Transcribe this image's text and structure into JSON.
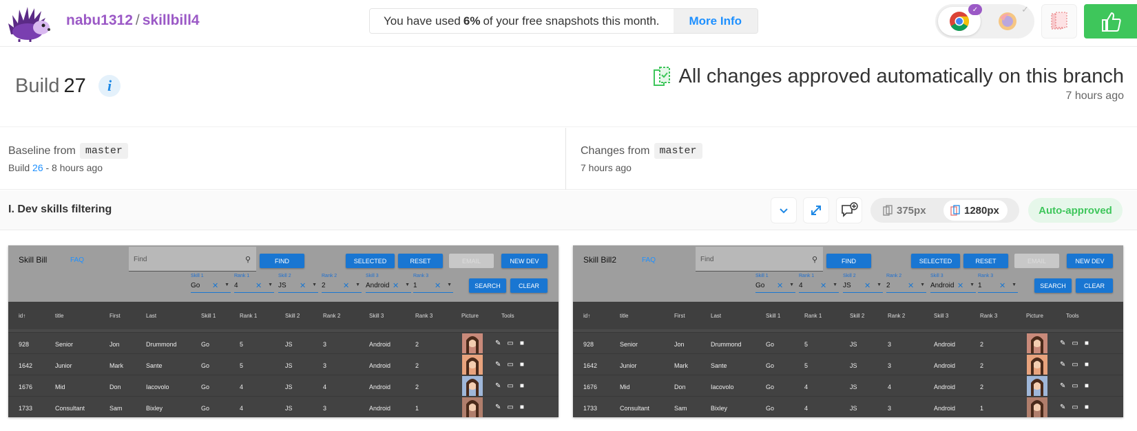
{
  "header": {
    "owner": "nabu1312",
    "separator": "/",
    "repo": "skillbill4",
    "notice_prefix": "You have used",
    "notice_percent": "6%",
    "notice_suffix": "of your free snapshots this month.",
    "notice_link": "More Info",
    "browser_badge": "✓",
    "browser_check": "✓"
  },
  "build": {
    "label": "Build",
    "number": "27",
    "info": "i",
    "status": "All changes approved automatically on this branch",
    "status_time": "7 hours ago"
  },
  "baseline": {
    "label": "Baseline from",
    "branch": "master",
    "build_prefix": "Build",
    "build_number": "26",
    "build_suffix": "- 8 hours ago"
  },
  "changes": {
    "label": "Changes from",
    "branch": "master",
    "time": "7 hours ago"
  },
  "snapshot": {
    "name": "I. Dev skills filtering",
    "width_small": "375px",
    "width_large": "1280px",
    "status": "Auto-approved"
  },
  "app_left": {
    "title": "Skill Bill",
    "faq": "FAQ"
  },
  "app_right": {
    "title": "Skill Bill2",
    "faq": "FAQ"
  },
  "app": {
    "find_placeholder": "Find",
    "find": "FIND",
    "selected": "SELECTED",
    "reset": "RESET",
    "email": "EMAIL",
    "new_dev": "NEW DEV",
    "search": "SEARCH",
    "clear": "CLEAR",
    "filters": [
      {
        "label": "Skill 1",
        "value": "Go"
      },
      {
        "label": "Rank 1",
        "value": "4"
      },
      {
        "label": "Skill 2",
        "value": "JS"
      },
      {
        "label": "Rank 2",
        "value": "2"
      },
      {
        "label": "Skill 3",
        "value": "Android"
      },
      {
        "label": "Rank 3",
        "value": "1"
      }
    ],
    "columns": [
      "id↑",
      "title",
      "First",
      "Last",
      "Skill 1",
      "Rank 1",
      "Skill 2",
      "Rank 2",
      "Skill 3",
      "Rank 3",
      "Picture",
      "Tools"
    ]
  },
  "rows_left": [
    [
      "928",
      "Senior",
      "Jon",
      "Drummond",
      "Go",
      "5",
      "JS",
      "3",
      "Android",
      "2"
    ],
    [
      "1642",
      "Junior",
      "Mark",
      "Sante",
      "Go",
      "5",
      "JS",
      "3",
      "Android",
      "2"
    ],
    [
      "1676",
      "Mid",
      "Don",
      "Iacovolo",
      "Go",
      "4",
      "JS",
      "4",
      "Android",
      "2"
    ],
    [
      "1733",
      "Consultant",
      "Sam",
      "Bixley",
      "Go",
      "4",
      "JS",
      "3",
      "Android",
      "1"
    ]
  ],
  "rows_right": [
    [
      "928",
      "Senior",
      "Jon",
      "Drummond",
      "Go",
      "5",
      "JS",
      "3",
      "Android",
      "2"
    ],
    [
      "1642",
      "Junior",
      "Mark",
      "Sante",
      "Go",
      "5",
      "JS",
      "3",
      "Android",
      "2"
    ],
    [
      "1676",
      "Mid",
      "Don",
      "Iacovolo",
      "Go",
      "4",
      "JS",
      "4",
      "Android",
      "2"
    ],
    [
      "1733",
      "Consultant",
      "Sam",
      "Bixley",
      "Go",
      "4",
      "JS",
      "3",
      "Android",
      "1"
    ]
  ],
  "colors": {
    "accent_purple": "#9b59c6",
    "link_blue": "#1e90ff",
    "approve_green": "#3ec65b",
    "app_blue": "#1976d2"
  }
}
